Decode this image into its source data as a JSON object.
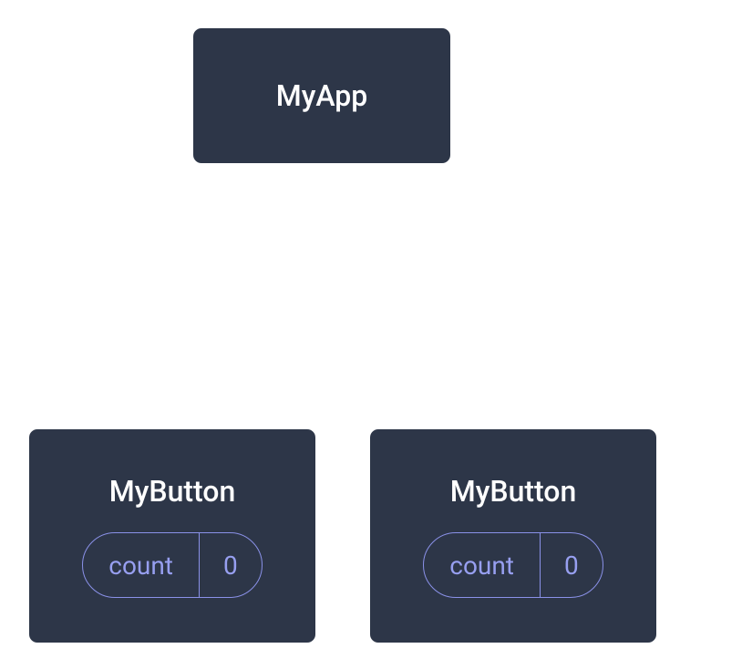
{
  "root": {
    "label": "MyApp"
  },
  "buttons": [
    {
      "label": "MyButton",
      "state_name": "count",
      "state_value": "0"
    },
    {
      "label": "MyButton",
      "state_name": "count",
      "state_value": "0"
    }
  ],
  "colors": {
    "box_bg": "#2d3648",
    "box_border": "#ffffff",
    "text_primary": "#ffffff",
    "accent_purple": "#979ff0",
    "accent_purple_border": "#8a91e8"
  }
}
